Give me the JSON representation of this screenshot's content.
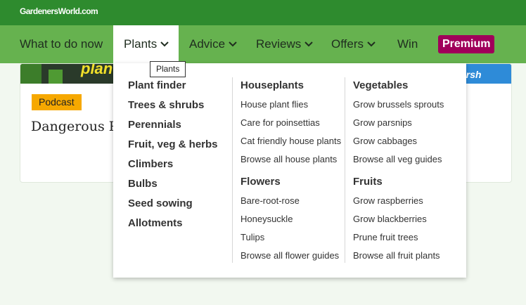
{
  "site": {
    "logo": "GardenersWorld.com"
  },
  "nav": {
    "items": [
      {
        "label": "What to do now"
      },
      {
        "label": "Plants"
      },
      {
        "label": "Advice"
      },
      {
        "label": "Reviews"
      },
      {
        "label": "Offers"
      },
      {
        "label": "Win"
      }
    ],
    "premium": "Premium"
  },
  "tooltip": "Plants",
  "card": {
    "image_text_left": "plan",
    "image_text_right": "arsh",
    "badge": "Podcast",
    "title": "Dangerous Pl"
  },
  "dropdown": {
    "main_links": [
      "Plant finder",
      "Trees & shrubs",
      "Perennials",
      "Fruit, veg & herbs",
      "Climbers",
      "Bulbs",
      "Seed sowing",
      "Allotments"
    ],
    "houseplants": {
      "title": "Houseplants",
      "links": [
        "House plant flies",
        "Care for poinsettias",
        "Cat friendly house plants",
        "Browse all house plants"
      ]
    },
    "flowers": {
      "title": "Flowers",
      "links": [
        "Bare-root-rose",
        "Honeysuckle",
        "Tulips",
        "Browse all flower guides"
      ]
    },
    "vegetables": {
      "title": "Vegetables",
      "links": [
        "Grow brussels sprouts",
        "Grow parsnips",
        "Grow cabbages",
        "Browse all veg guides"
      ]
    },
    "fruits": {
      "title": "Fruits",
      "links": [
        "Grow raspberries",
        "Grow blackberries",
        "Prune fruit trees",
        "Browse all fruit plants"
      ]
    }
  },
  "colors": {
    "topbar": "#2e8b2e",
    "nav": "#66b24f",
    "premium": "#a0005a",
    "badge": "#f6a800"
  }
}
